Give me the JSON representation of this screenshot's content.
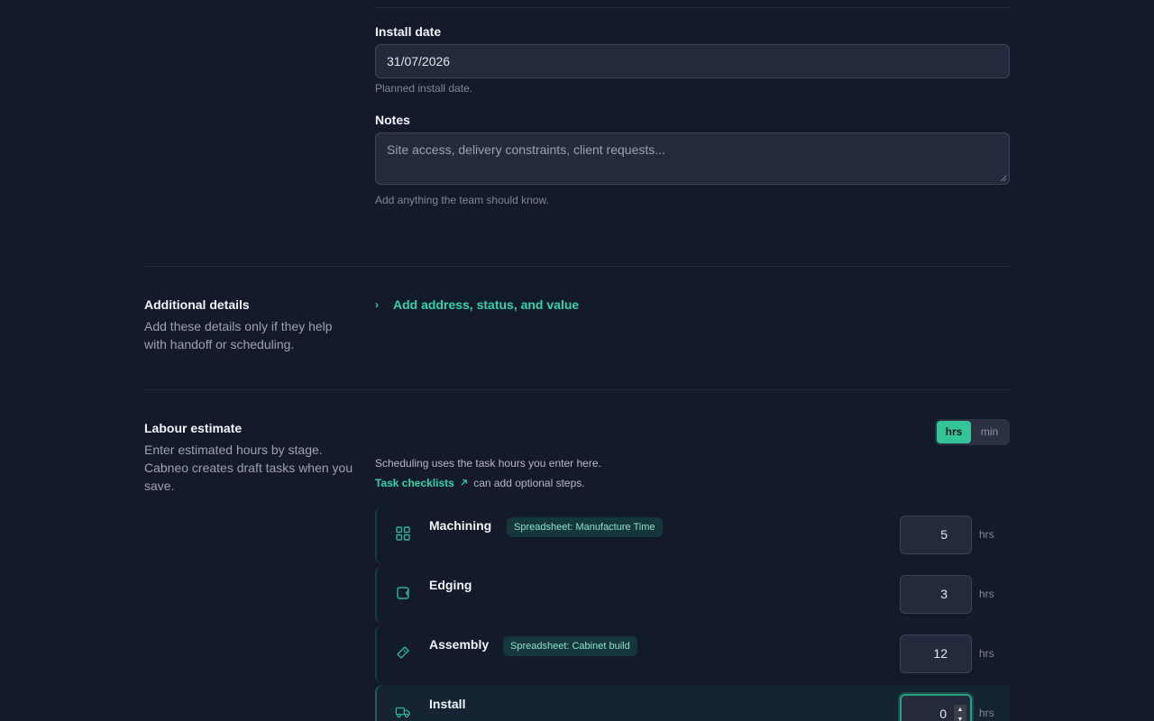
{
  "install_date": {
    "label": "Install date",
    "value": "31/07/2026",
    "help": "Planned install date."
  },
  "notes": {
    "label": "Notes",
    "placeholder": "Site access, delivery constraints, client requests...",
    "help": "Add anything the team should know."
  },
  "additional_details": {
    "title": "Additional details",
    "description": "Add these details only if they help with handoff or scheduling.",
    "expander_label": "Add address, status, and value"
  },
  "labour_estimate": {
    "title": "Labour estimate",
    "description": "Enter estimated hours by stage. Cabneo creates draft tasks when you save.",
    "unit_options": [
      "hrs",
      "min"
    ],
    "selected_unit": "hrs",
    "scheduling_note": "Scheduling uses the task hours you enter here.",
    "checklist_link": "Task checklists",
    "checklist_link_icon": "arrow-up-right-icon",
    "checklist_rest": "can add optional steps.",
    "stages": [
      {
        "name": "Machining",
        "icon": "grid-icon",
        "badge": "Spreadsheet: Manufacture Time",
        "hours": "5",
        "unit": "hrs"
      },
      {
        "name": "Edging",
        "icon": "edge-icon",
        "badge": "",
        "hours": "3",
        "unit": "hrs"
      },
      {
        "name": "Assembly",
        "icon": "tag-icon",
        "badge": "Spreadsheet: Cabinet build",
        "hours": "12",
        "unit": "hrs"
      },
      {
        "name": "Install",
        "icon": "truck-icon",
        "badge": "",
        "hours": "0",
        "unit": "hrs"
      }
    ]
  },
  "colors": {
    "background": "#131a2a",
    "accent": "#2dd4ad",
    "toggle_active": "#34c49a"
  }
}
